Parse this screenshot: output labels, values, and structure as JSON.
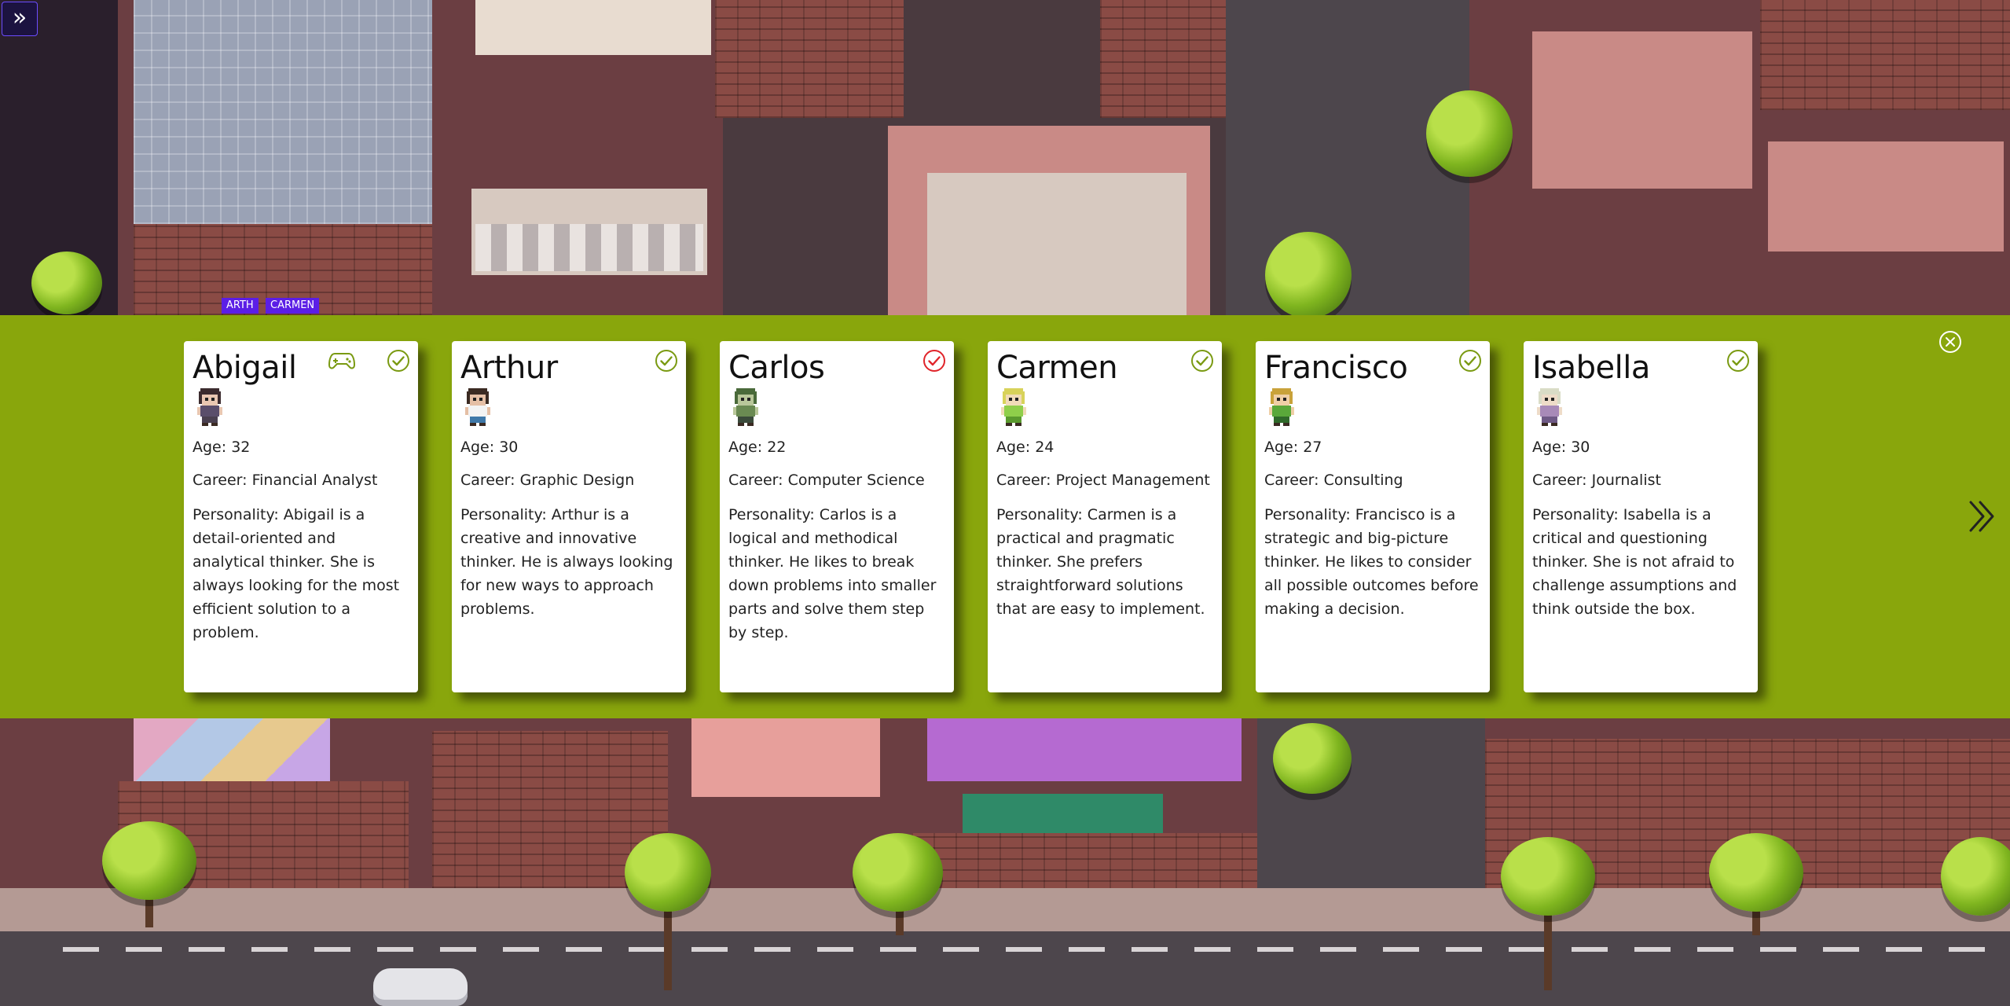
{
  "toggle": {
    "label": "»",
    "icon": "double-chevron-right-icon"
  },
  "name_tags": [
    "ARTH",
    "CARMEN"
  ],
  "colors": {
    "panel": "#89a60c",
    "check_ok": "#7a9a12",
    "check_bad": "#e0242a",
    "toggle_bg": "#1c1340",
    "name_tag_bg": "#5b1ee6"
  },
  "cards": [
    {
      "name": "Abigail",
      "age": "Age: 32",
      "career": "Career: Financial Analyst",
      "personality": "Personality: Abigail is a detail-oriented and analytical thinker. She is always looking for the most efficient solution to a problem.",
      "status": "check",
      "has_game_icon": true,
      "sprite": {
        "hair": "#3b2b2e",
        "skin": "#e9c7b1",
        "shirt": "#5a4e6b",
        "pants": "#4a4050"
      }
    },
    {
      "name": "Arthur",
      "age": "Age: 30",
      "career": "Career: Graphic Design",
      "personality": "Personality: Arthur is a creative and innovative thinker. He is always looking for new ways to approach problems.",
      "status": "check",
      "has_game_icon": false,
      "sprite": {
        "hair": "#3a2a22",
        "skin": "#e5bfa5",
        "shirt": "#f3f3f3",
        "pants": "#3f78a8"
      }
    },
    {
      "name": "Carlos",
      "age": "Age: 22",
      "career": "Career: Computer Science",
      "personality": "Personality: Carlos is a logical and methodical thinker. He likes to break down problems into smaller parts and solve them step by step.",
      "status": "error",
      "has_game_icon": false,
      "sprite": {
        "hair": "#4a6a3a",
        "skin": "#b9c79a",
        "shirt": "#6a8a52",
        "pants": "#3a4a3a"
      }
    },
    {
      "name": "Carmen",
      "age": "Age: 24",
      "career": "Career: Project Management",
      "personality": "Personality: Carmen is a practical and pragmatic thinker. She prefers straightforward solutions that are easy to implement.",
      "status": "check",
      "has_game_icon": false,
      "sprite": {
        "hair": "#d8d25a",
        "skin": "#f1dbb8",
        "shirt": "#8fcf4a",
        "pants": "#5a9a2e"
      }
    },
    {
      "name": "Francisco",
      "age": "Age: 27",
      "career": "Career: Consulting",
      "personality": "Personality: Francisco is a strategic and big-picture thinker. He likes to consider all possible outcomes before making a decision.",
      "status": "check",
      "has_game_icon": false,
      "sprite": {
        "hair": "#c9a23a",
        "skin": "#efcfa6",
        "shirt": "#5aa83a",
        "pants": "#2f6a2a"
      }
    },
    {
      "name": "Isabella",
      "age": "Age: 30",
      "career": "Career: Journalist",
      "personality": "Personality: Isabella is a critical and questioning thinker. She is not afraid to challenge assumptions and think outside the box.",
      "status": "check",
      "has_game_icon": false,
      "sprite": {
        "hair": "#d9dcc6",
        "skin": "#eedcc8",
        "shirt": "#a88ab8",
        "pants": "#6f5a86"
      }
    }
  ],
  "panel_controls": {
    "close_icon": "close-circle-icon",
    "next_icon": "double-chevron-right-icon"
  }
}
